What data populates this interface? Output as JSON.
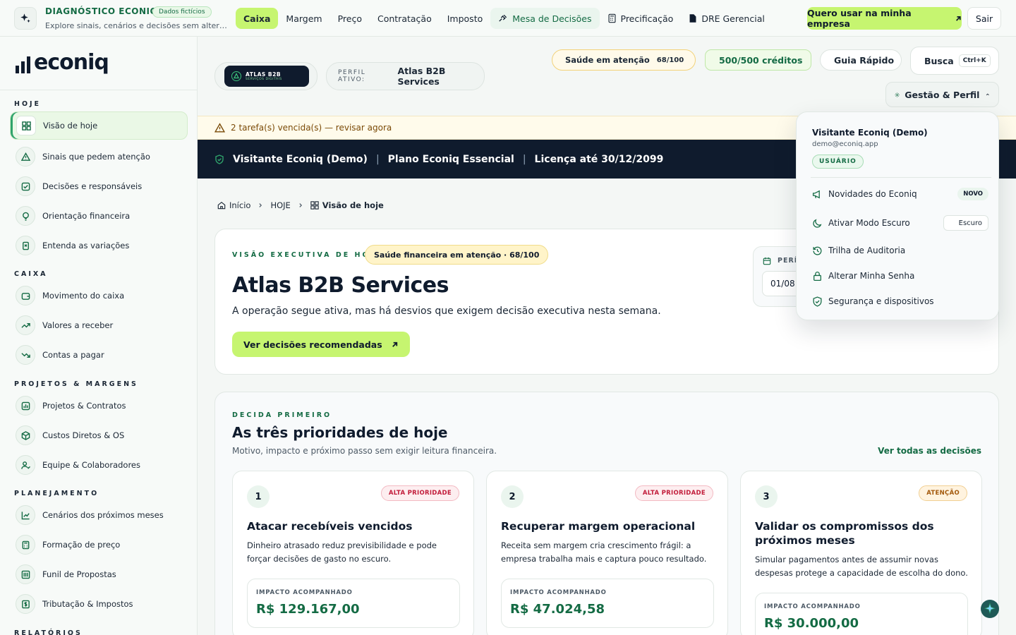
{
  "topbar": {
    "title": "DIAGNÓSTICO ECONIQ",
    "badge": "Dados fictícios",
    "subtitle": "Explore sinais, cenários e decisões sem alterar dados reais.",
    "nav": [
      "Caixa",
      "Margem",
      "Preço",
      "Contratação",
      "Imposto",
      "Mesa de Decisões",
      "Precificação",
      "DRE Gerencial"
    ],
    "cta": "Quero usar na minha empresa",
    "logout": "Sair"
  },
  "sidebar": {
    "brand": "econiq",
    "sections": [
      {
        "label": "HOJE",
        "items": [
          "Visão de hoje",
          "Sinais que pedem atenção",
          "Decisões e responsáveis",
          "Orientação financeira",
          "Entenda as variações"
        ]
      },
      {
        "label": "CAIXA",
        "items": [
          "Movimento do caixa",
          "Valores a receber",
          "Contas a pagar"
        ]
      },
      {
        "label": "PROJETOS & MARGENS",
        "items": [
          "Projetos & Contratos",
          "Custos Diretos & OS",
          "Equipe & Colaboradores"
        ]
      },
      {
        "label": "PLANEJAMENTO",
        "items": [
          "Cenários dos próximos meses",
          "Formação de preço",
          "Funil de Propostas",
          "Tributação & Impostos"
        ]
      },
      {
        "label": "RELATÓRIOS",
        "items": []
      }
    ]
  },
  "header": {
    "company_logo_title": "ATLAS B2B",
    "company_logo_sub": "SERVIÇOS DIGITAIS",
    "profile_label": "PERFIL ATIVO:",
    "profile_value": "Atlas B2B Services",
    "health_label": "Saúde em atenção",
    "health_score": "68/100",
    "credits": "500/500 créditos",
    "guide": "Guia Rápido",
    "search": "Busca",
    "search_kbd": "Ctrl+K",
    "manage": "Gestão & Perfil"
  },
  "alert": "2 tarefa(s) vencida(s) — revisar agora",
  "license": {
    "user": "Visitante Econiq (Demo)",
    "plan": "Plano Econiq Essencial",
    "valid": "Licença até 30/12/2099"
  },
  "breadcrumb": [
    "Início",
    "HOJE",
    "Visão de hoje"
  ],
  "overview": {
    "eyebrow": "VISÃO EXECUTIVA DE HOJE",
    "health_tag": "Saúde financeira em atenção · 68/100",
    "title": "Atlas B2B Services",
    "lead": "A operação segue ativa, mas há desvios que exigem decisão executiva nesta semana.",
    "cta": "Ver decisões recomendadas",
    "period_label": "PERÍ",
    "period_value": "01/08"
  },
  "priorities": {
    "eyebrow": "DECIDA PRIMEIRO",
    "title": "As três prioridades de hoje",
    "subtitle": "Motivo, impacto e próximo passo sem exigir leitura financeira.",
    "link": "Ver todas as decisões",
    "impact_label": "IMPACTO ACOMPANHADO",
    "cards": [
      {
        "num": "1",
        "badge": "ALTA PRIORIDADE",
        "title": "Atacar recebíveis vencidos",
        "desc": "Dinheiro atrasado reduz previsibilidade e pode forçar decisões de gasto no escuro.",
        "impact": "R$ 129.167,00"
      },
      {
        "num": "2",
        "badge": "ALTA PRIORIDADE",
        "title": "Recuperar margem operacional",
        "desc": "Receita sem margem cria crescimento frágil: a empresa trabalha mais e captura pouco resultado.",
        "impact": "R$ 47.024,58"
      },
      {
        "num": "3",
        "badge": "ATENÇÃO",
        "title": "Validar os compromissos dos próximos meses",
        "desc": "Simular pagamentos antes de assumir novas despesas protege a capacidade de escolha do dono.",
        "impact": "R$ 30.000,00"
      }
    ]
  },
  "dropdown": {
    "name": "Visitante Econiq (Demo)",
    "email": "demo@econiq.app",
    "role": "USUÁRIO",
    "items": [
      "Novidades do Econiq",
      "Ativar Modo Escuro",
      "Trilha de Auditoria",
      "Alterar Minha Senha",
      "Segurança e dispositivos"
    ],
    "new_badge": "NOVO",
    "dark_badge": "Escuro"
  },
  "colors": {
    "accent": "#c6f570",
    "brand_green": "#146b44",
    "dark": "#0f1b2d",
    "warning": "#f59e0b",
    "danger": "#c21d3b"
  }
}
